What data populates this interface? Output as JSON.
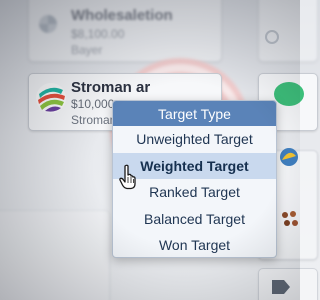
{
  "cards": {
    "top": {
      "title": "Wholesaletion",
      "line1": "$8,100.00",
      "line2": "Bayer"
    },
    "main": {
      "title": "Stroman ar",
      "line1": "$10,000.",
      "line2": "Stroman"
    }
  },
  "dropdown": {
    "header": "Target Type",
    "items": [
      {
        "label": "Unweighted Target"
      },
      {
        "label": "Weighted Target",
        "selected": true
      },
      {
        "label": "Ranked Target"
      },
      {
        "label": "Balanced Target"
      },
      {
        "label": "Won Target"
      }
    ]
  },
  "colors": {
    "dropdown_header": "#5a83b8",
    "selected_item": "#c9d9ee",
    "text": "#1f3552"
  },
  "icons": [
    "pointer-hand-icon",
    "company-logo-icon"
  ]
}
